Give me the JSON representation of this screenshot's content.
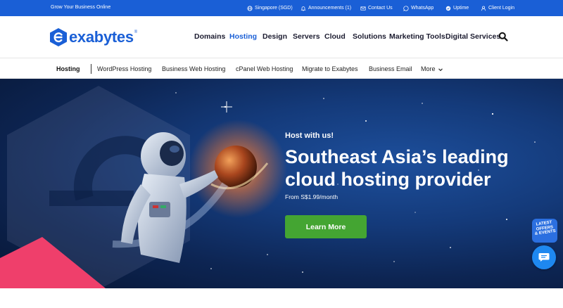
{
  "topbar": {
    "tagline": "Grow Your Business Online",
    "links": [
      {
        "label": "Singapore (SGD)",
        "icon": "globe-icon"
      },
      {
        "label": "Announcements (1)",
        "icon": "bell-icon"
      },
      {
        "label": "Contact Us",
        "icon": "mail-icon"
      },
      {
        "label": "WhatsApp",
        "icon": "whatsapp-icon"
      },
      {
        "label": "Uptime",
        "icon": "uptime-icon"
      },
      {
        "label": "Client Login",
        "icon": "user-icon"
      }
    ]
  },
  "brand": {
    "name": "exabytes",
    "mark": "®"
  },
  "nav": {
    "items": [
      "Domains",
      "Hosting",
      "Design",
      "Servers",
      "Cloud",
      "Solutions",
      "Marketing Tools",
      "Digital Services"
    ],
    "active": "Hosting",
    "search_icon": "search-icon"
  },
  "subnav": {
    "current": "Hosting",
    "items": [
      "WordPress Hosting",
      "Business Web Hosting",
      "cPanel Web Hosting",
      "Migrate to Exabytes",
      "Business Email"
    ],
    "more": "More"
  },
  "hero": {
    "kicker": "Host with us!",
    "title_line1": "Southeast Asia’s leading",
    "title_line2": "cloud hosting provider",
    "price": "From S$1.99/month",
    "cta": "Learn More"
  },
  "widgets": {
    "offers_lines": [
      "LATEST",
      "OFFERS",
      "& EVENTS"
    ],
    "chat_icon": "chat-icon"
  },
  "colors": {
    "brand_blue": "#1a5fd6",
    "cta_green": "#44a532",
    "accent_pink": "#ef3f6b",
    "hero_navy": "#0d2553"
  }
}
